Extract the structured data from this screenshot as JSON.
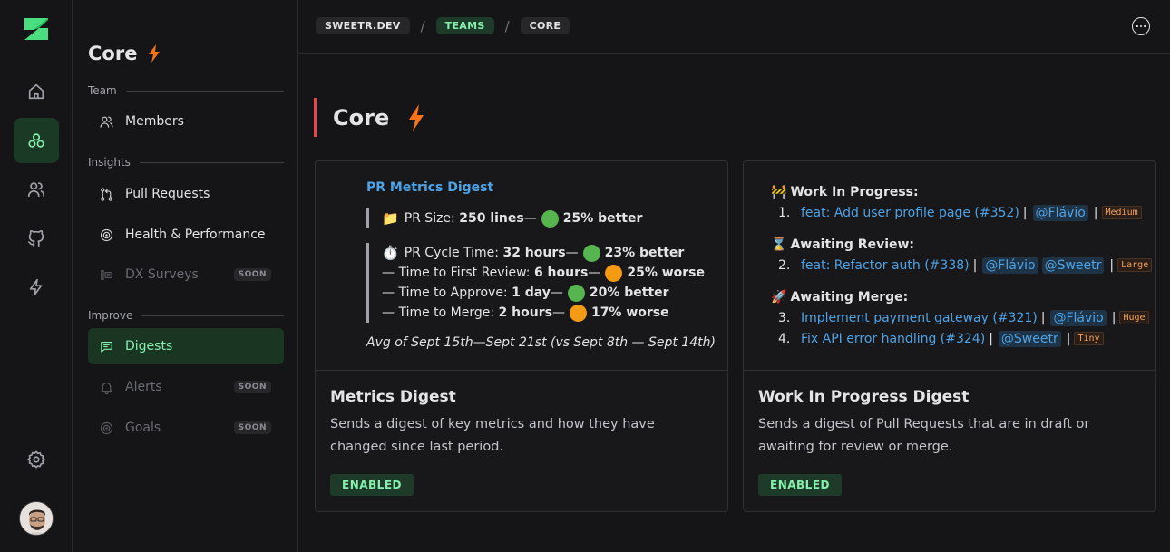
{
  "breadcrumbs": [
    "SWEETR.DEV",
    "TEAMS",
    "CORE"
  ],
  "breadcrumb_separator": "/",
  "team": {
    "name": "Core",
    "icon": "lightning-icon"
  },
  "sidebar": {
    "sections": {
      "team": "Team",
      "insights": "Insights",
      "improve": "Improve"
    },
    "items": [
      {
        "label": "Members",
        "icon": "users-icon"
      },
      {
        "label": "Pull Requests",
        "icon": "git-pull-request-icon"
      },
      {
        "label": "Health & Performance",
        "icon": "health-icon"
      },
      {
        "label": "DX Surveys",
        "icon": "survey-icon",
        "badge": "SOON"
      },
      {
        "label": "Digests",
        "icon": "message-icon"
      },
      {
        "label": "Alerts",
        "icon": "bell-icon",
        "badge": "SOON"
      },
      {
        "label": "Goals",
        "icon": "target-icon",
        "badge": "SOON"
      }
    ]
  },
  "cards": [
    {
      "title": "Metrics Digest",
      "description": "Sends a digest of key metrics and how they have changed since last period.",
      "status": "ENABLED",
      "preview": {
        "heading": "PR Metrics Digest",
        "pr_size": {
          "emoji": "📁",
          "label": "PR Size: ",
          "value": "250 lines",
          "dash": " —",
          "change": "25% better"
        },
        "cycle_time": {
          "emoji": "⏱️",
          "label": "PR Cycle Time: ",
          "value": "32 hours",
          "dash": " —",
          "change": "23% better"
        },
        "first_review": {
          "label": "— Time to First Review: ",
          "value": "6 hours",
          "dash": " —",
          "change": "25% worse"
        },
        "approve": {
          "label": "— Time to Approve: ",
          "value": "1 day",
          "dash": " —",
          "change": "20% better"
        },
        "merge": {
          "label": "— Time to Merge: ",
          "value": "2 hours",
          "dash": " —",
          "change": "17% worse"
        },
        "footer": "Avg of Sept 15th—Sept 21st (vs Sept 8th — Sept 14th)"
      }
    },
    {
      "title": "Work In Progress Digest",
      "description": "Sends a digest of Pull Requests that are in draft or awaiting for review or merge.",
      "status": "ENABLED",
      "preview": {
        "wip": {
          "emoji": "🚧",
          "label": "Work In Progress:"
        },
        "review": {
          "emoji": "⌛",
          "label": "Awaiting Review:"
        },
        "merge": {
          "emoji": "🚀",
          "label": "Awaiting Merge:"
        },
        "items": [
          {
            "num": "1.",
            "title": "feat: Add user profile page (#352)",
            "mentions": [
              "@Flávio"
            ],
            "size": "Medium"
          },
          {
            "num": "2.",
            "title": "feat: Refactor auth (#338)",
            "mentions": [
              "@Flávio",
              "@Sweetr"
            ],
            "size": "Large"
          },
          {
            "num": "3.",
            "title": "Implement payment gateway (#321)",
            "mentions": [
              "@Flávio"
            ],
            "size": "Huge"
          },
          {
            "num": "4.",
            "title": "Fix API error handling (#324)",
            "mentions": [
              "@Sweetr"
            ],
            "size": "Tiny"
          }
        ],
        "separator": "|"
      }
    }
  ],
  "colors": {
    "accent": "#86efac",
    "link": "#4ea3e6",
    "title_bar": "#ef4444",
    "better": "#56b54e",
    "worse": "#f59a13"
  }
}
